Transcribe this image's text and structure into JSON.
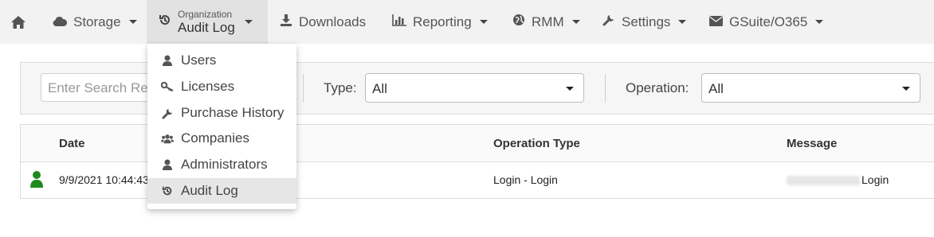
{
  "nav": {
    "home_icon": "home-icon",
    "items": [
      {
        "label": "Storage",
        "icon": "cloud-icon"
      },
      {
        "small": "Organization",
        "label": "Audit Log",
        "icon": "history-icon"
      },
      {
        "label": "Downloads",
        "icon": "download-icon"
      },
      {
        "label": "Reporting",
        "icon": "bar-chart-icon"
      },
      {
        "label": "RMM",
        "icon": "globe-icon"
      },
      {
        "label": "Settings",
        "icon": "wrench-icon"
      },
      {
        "label": "GSuite/O365",
        "icon": "envelope-icon"
      }
    ]
  },
  "dropdown": {
    "items": [
      {
        "label": "Users",
        "icon": "user-icon"
      },
      {
        "label": "Licenses",
        "icon": "key-icon"
      },
      {
        "label": "Purchase History",
        "icon": "wrench-icon"
      },
      {
        "label": "Companies",
        "icon": "users-icon"
      },
      {
        "label": "Administrators",
        "icon": "user-icon"
      },
      {
        "label": "Audit Log",
        "icon": "history-icon"
      }
    ]
  },
  "filter": {
    "search_placeholder": "Enter Search Re",
    "type_label": "Type:",
    "type_value": "All",
    "operation_label": "Operation:",
    "operation_value": "All"
  },
  "table": {
    "headers": {
      "date": "Date",
      "operation_type": "Operation Type",
      "message": "Message"
    },
    "rows": [
      {
        "date": "9/9/2021 10:44:43",
        "operation_type": "Login - Login",
        "message": "Login",
        "status_color": "#1e8a1e"
      }
    ]
  }
}
